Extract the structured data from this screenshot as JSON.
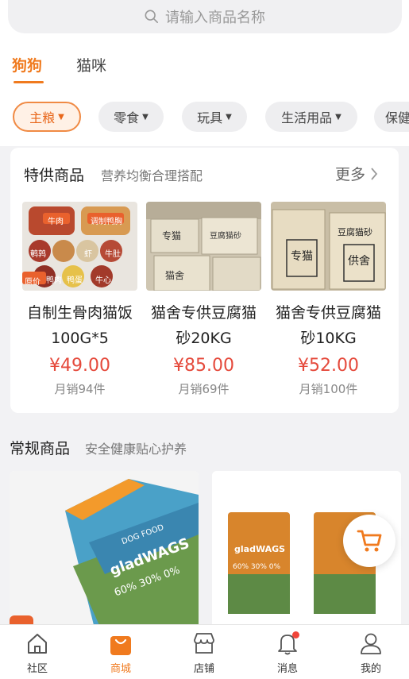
{
  "search": {
    "placeholder": "请输入商品名称",
    "icon": "search-icon"
  },
  "tabs": [
    {
      "label": "狗狗",
      "active": true
    },
    {
      "label": "猫咪",
      "active": false
    }
  ],
  "categories": [
    {
      "label": "主粮",
      "active": true
    },
    {
      "label": "零食",
      "active": false
    },
    {
      "label": "玩具",
      "active": false
    },
    {
      "label": "生活用品",
      "active": false
    },
    {
      "label": "保健",
      "active": false
    }
  ],
  "special": {
    "title": "特供商品",
    "subtitle": "营养均衡合理搭配",
    "more_label": "更多",
    "products": [
      {
        "name": "自制生骨肉猫饭100G*5",
        "price": "¥49.00",
        "sales": "月销94件",
        "image_badge": "原价",
        "image_labels": [
          "牛肉",
          "调制鸭胸",
          "鹌鹑",
          "虾",
          "牛肚",
          "鸭肉",
          "鸭蛋",
          "牛心"
        ]
      },
      {
        "name": "猫舍专供豆腐猫砂20KG",
        "price": "¥85.00",
        "sales": "月销69件",
        "image_labels": [
          "专猫",
          "猫舍",
          "豆腐猫砂"
        ]
      },
      {
        "name": "猫舍专供豆腐猫砂10KG",
        "price": "¥52.00",
        "sales": "月销100件",
        "image_labels": [
          "专猫",
          "供舍",
          "豆腐猫砂"
        ]
      }
    ]
  },
  "regular": {
    "title": "常规商品",
    "subtitle": "安全健康贴心护养",
    "products": [
      {
        "brand_text": "gladWAGS",
        "ratio_text": "60% 30% 0%",
        "tag": "DOG FOOD"
      },
      {
        "brand_text": "gladWAGS",
        "ratio_text": "60% 30% 0%"
      }
    ]
  },
  "cart_fab_icon": "cart-icon",
  "bottom_nav": [
    {
      "label": "社区",
      "icon": "home-icon",
      "active": false
    },
    {
      "label": "商城",
      "icon": "shopping-bag-icon",
      "active": true
    },
    {
      "label": "店铺",
      "icon": "store-icon",
      "active": false
    },
    {
      "label": "消息",
      "icon": "bell-icon",
      "active": false,
      "has_dot": true
    },
    {
      "label": "我的",
      "icon": "user-icon",
      "active": false
    }
  ],
  "colors": {
    "accent": "#f07a1e",
    "price": "#e54a3c",
    "background": "#f2f2f4"
  }
}
